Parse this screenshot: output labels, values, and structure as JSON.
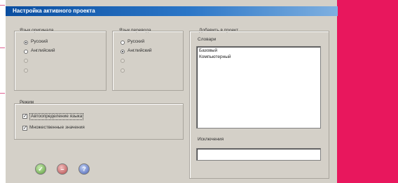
{
  "dialog": {
    "title": "Настройка активного проекта",
    "source_language": {
      "label": "Язык оригинала",
      "options": [
        "Русский",
        "Английский",
        "",
        ""
      ],
      "selected": 0
    },
    "target_language": {
      "label": "Язык перевода",
      "options": [
        "Русский",
        "Английский",
        "",
        ""
      ],
      "selected": 1
    },
    "mode": {
      "label": "Режим",
      "options": [
        {
          "label": "Автоопределение языка",
          "checked": true
        },
        {
          "label": "Множественные значения",
          "checked": true
        }
      ]
    },
    "add_to_project": {
      "label": "Добавить в проект",
      "dictionaries_label": "Словари",
      "dictionaries": [
        "Базовый",
        "Компьютерный"
      ],
      "exceptions_label": "Исключения",
      "exceptions_value": ""
    },
    "buttons": [
      {
        "name": "ok",
        "icon": "check-icon",
        "glyph": "✓"
      },
      {
        "name": "cancel",
        "icon": "minus-icon",
        "glyph": "–"
      },
      {
        "name": "help",
        "icon": "question-icon",
        "glyph": "?"
      }
    ]
  },
  "colors": {
    "title_bar": "#0a4ea0",
    "dialog_bg": "#d4d0c8",
    "accent_panel": "#e8175d"
  }
}
